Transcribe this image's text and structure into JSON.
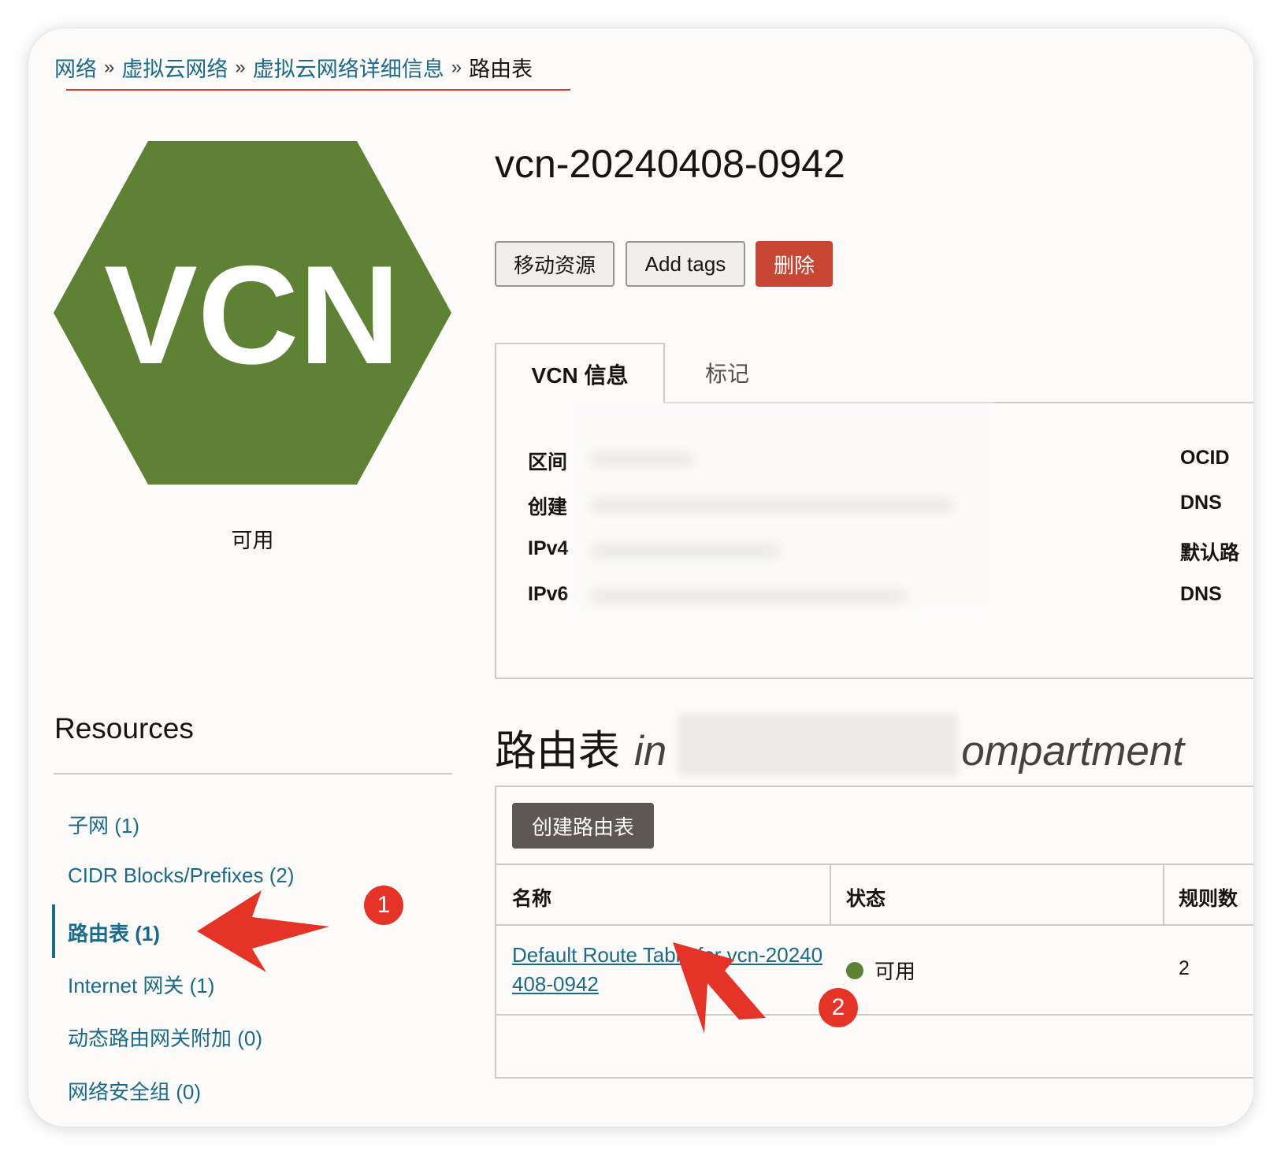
{
  "breadcrumb": {
    "items": [
      "网络",
      "虚拟云网络",
      "虚拟云网络详细信息"
    ],
    "separator": "»",
    "current": "路由表"
  },
  "resource": {
    "badge_text": "VCN",
    "status": "可用",
    "title": "vcn-20240408-0942"
  },
  "actions": {
    "move": "移动资源",
    "add_tags": "Add tags",
    "delete": "删除"
  },
  "tabs": {
    "info": "VCN 信息",
    "tags": "标记"
  },
  "info": {
    "left_labels": [
      "区间",
      "创建",
      "IPv4",
      "IPv6"
    ],
    "right_labels": [
      "OCID",
      "DNS",
      "默认路",
      "DNS"
    ]
  },
  "resources_panel": {
    "title": "Resources",
    "items": [
      {
        "label": "子网 (1)"
      },
      {
        "label": "CIDR Blocks/Prefixes (2)"
      },
      {
        "label": "路由表 (1)"
      },
      {
        "label": "Internet 网关 (1)"
      },
      {
        "label": "动态路由网关附加 (0)"
      },
      {
        "label": "网络安全组 (0)"
      }
    ]
  },
  "route_tables": {
    "heading": "路由表",
    "heading_in": "in",
    "heading_suffix": "ompartment",
    "create_button": "创建路由表",
    "columns": [
      "名称",
      "状态",
      "规则数"
    ],
    "rows": [
      {
        "name": "Default Route Table for vcn-20240408-0942",
        "status": "可用",
        "rules": "2"
      }
    ]
  },
  "annotations": {
    "badge1": "1",
    "badge2": "2"
  },
  "colors": {
    "accent_link": "#1a6b8a",
    "hex_green": "#5d8234",
    "delete_red": "#c74634",
    "annotation_red": "#e53327",
    "status_green": "#5d8234"
  }
}
